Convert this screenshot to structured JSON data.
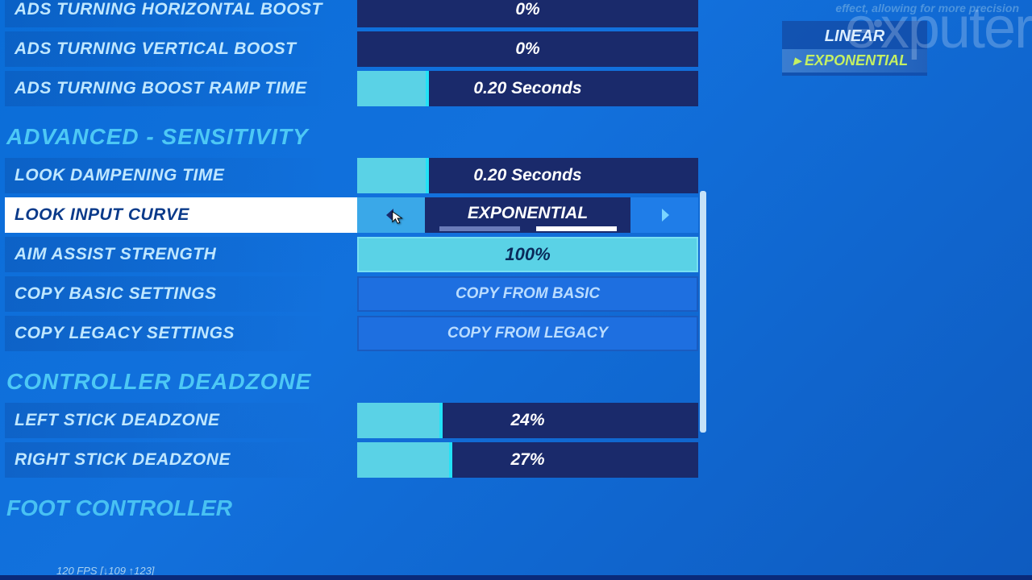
{
  "rows_top": [
    {
      "label": "ADS TURNING HORIZONTAL BOOST",
      "value": "0%",
      "fill": 0
    },
    {
      "label": "ADS TURNING VERTICAL BOOST",
      "value": "0%",
      "fill": 0
    },
    {
      "label": "ADS TURNING BOOST RAMP TIME",
      "value": "0.20 Seconds",
      "fill": 20
    }
  ],
  "section_sensitivity": "ADVANCED - SENSITIVITY",
  "look_dampening": {
    "label": "LOOK DAMPENING TIME",
    "value": "0.20 Seconds",
    "fill": 20
  },
  "look_curve": {
    "label": "LOOK INPUT CURVE",
    "value": "EXPONENTIAL"
  },
  "aim_assist": {
    "label": "AIM ASSIST STRENGTH",
    "value": "100%"
  },
  "copy_basic": {
    "label": "COPY BASIC SETTINGS",
    "btn": "COPY FROM BASIC"
  },
  "copy_legacy": {
    "label": "COPY LEGACY SETTINGS",
    "btn": "COPY FROM LEGACY"
  },
  "section_deadzone": "CONTROLLER DEADZONE",
  "deadzone": [
    {
      "label": "LEFT STICK DEADZONE",
      "value": "24%",
      "fill": 24
    },
    {
      "label": "RIGHT STICK DEADZONE",
      "value": "27%",
      "fill": 27
    }
  ],
  "section_foot": "FOOT CONTROLLER",
  "side": {
    "truncated": "effect, allowing for more precision",
    "linear": "LINEAR",
    "exponential": "EXPONENTIAL"
  },
  "footer": "120 FPS [↓109 ↑123]",
  "watermark": "exputer"
}
